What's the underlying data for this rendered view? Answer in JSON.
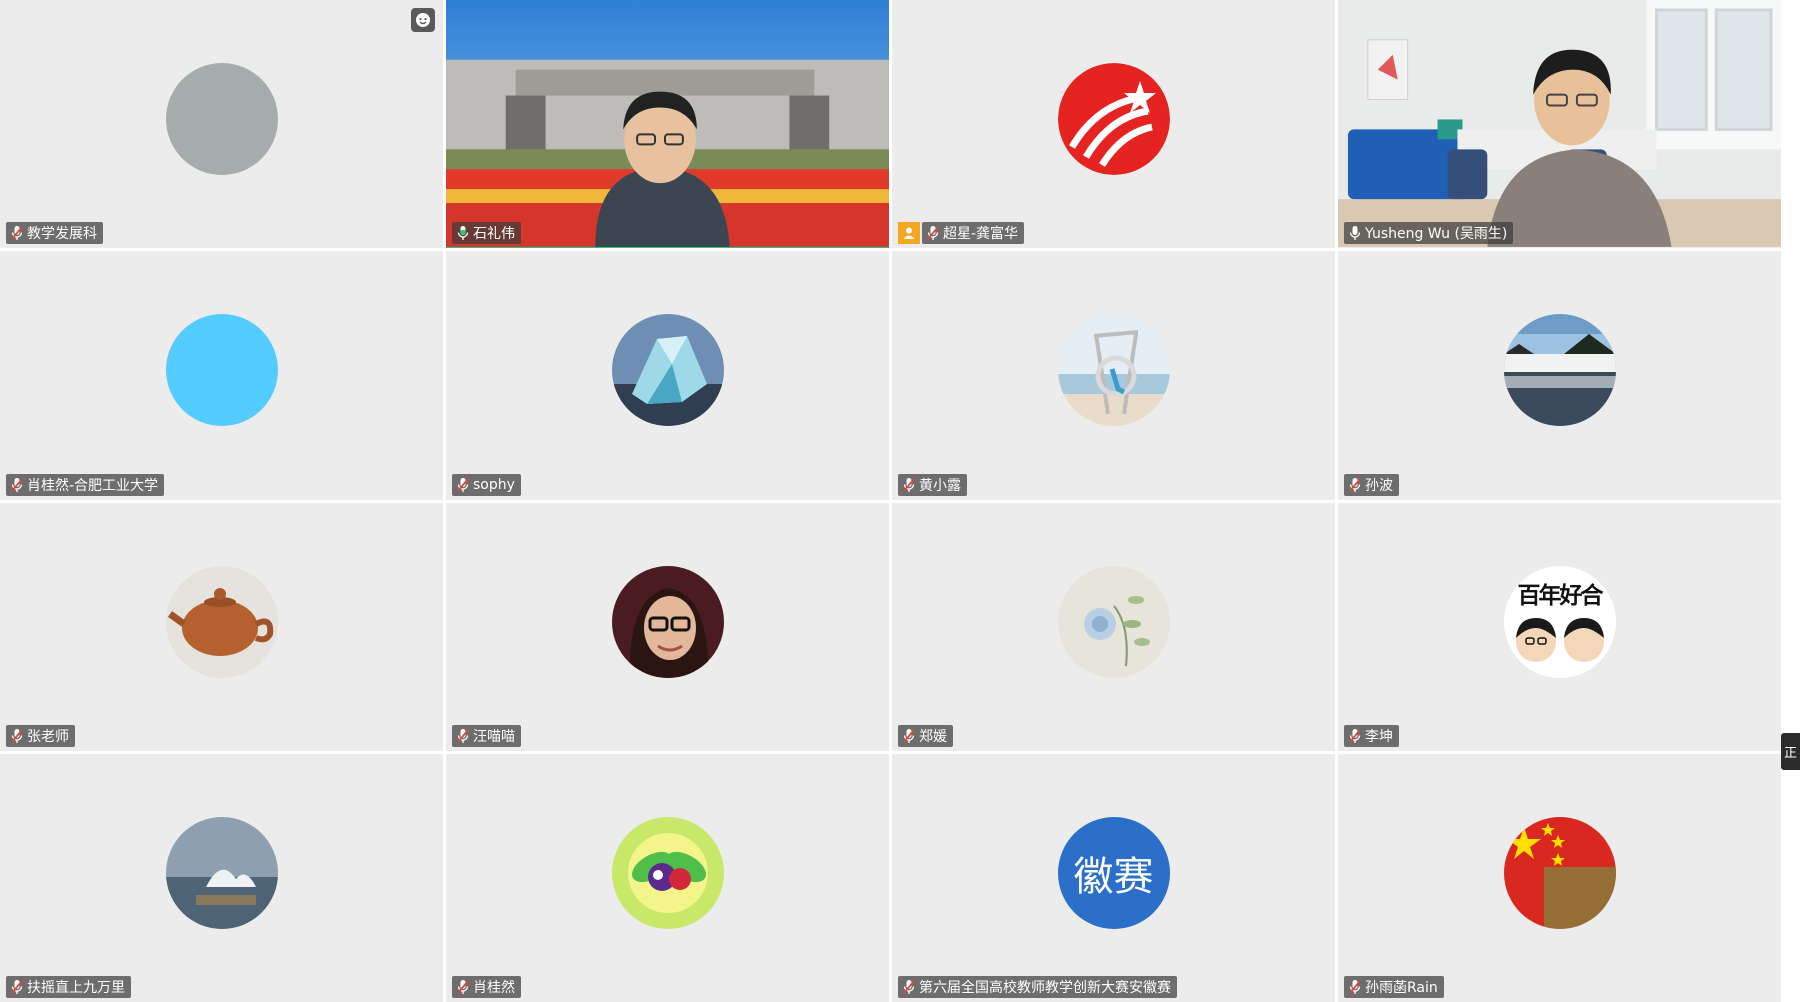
{
  "participants": [
    {
      "name": "教学发展科",
      "mic": "muted"
    },
    {
      "name": "石礼伟",
      "mic": "active"
    },
    {
      "name": "超星-龚富华",
      "mic": "muted",
      "host": true
    },
    {
      "name": "Yusheng Wu (吴雨生)",
      "mic": "on"
    },
    {
      "name": "肖桂然-合肥工业大学",
      "mic": "muted"
    },
    {
      "name": "sophy",
      "mic": "muted"
    },
    {
      "name": "黄小露",
      "mic": "muted"
    },
    {
      "name": "孙波",
      "mic": "muted"
    },
    {
      "name": "张老师",
      "mic": "muted"
    },
    {
      "name": "汪喵喵",
      "mic": "muted"
    },
    {
      "name": "郑媛",
      "mic": "muted"
    },
    {
      "name": "李坤",
      "mic": "muted"
    },
    {
      "name": "扶摇直上九万里",
      "mic": "muted"
    },
    {
      "name": "肖桂然",
      "mic": "muted"
    },
    {
      "name": "第六届全国高校教师教学创新大赛安徽赛",
      "mic": "muted"
    },
    {
      "name": "孙雨菡Rain",
      "mic": "muted"
    }
  ],
  "avatar_text": {
    "hui_sai": "徽赛",
    "bainian": "百年好合"
  },
  "edge_tab_label": "正",
  "colors": {
    "active_border": "#22c483",
    "tile_bg": "#ececec",
    "host_badge": "#f5a623",
    "blue_avatar": "#55ccff",
    "huisai_avatar": "#2b6fc9"
  }
}
